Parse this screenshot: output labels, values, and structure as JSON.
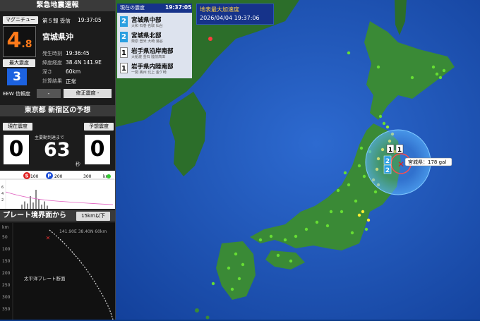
{
  "eew": {
    "title": "緊急地震速報",
    "magnitude_label": "マグニチュード",
    "report_info": "第５報 受信",
    "report_time": "19:37:05",
    "magnitude_int": "4",
    "magnitude_dec": ".8",
    "region": "宮城県沖",
    "origin_time_key": "発生時刻",
    "origin_time": "19:36:45",
    "latlon_key": "緯度経度",
    "latlon": "38.4N 141.9E",
    "max_intensity_label": "最大震度",
    "max_intensity": "3",
    "depth_key": "深さ",
    "depth": "60km",
    "calc_key": "計算結果",
    "calc_result": "正常",
    "reliability_label": "EEW 信頼度",
    "reliability_value": "-",
    "revise_label": "修正震度",
    "revise_value": "-"
  },
  "forecast": {
    "title": "東京都 新宿区の予想",
    "current_label": "現在震度",
    "current_value": "0",
    "arrival_label": "主要動到達まで",
    "seconds": "63",
    "seconds_unit": "秒",
    "predicted_label": "予想震度",
    "predicted_value": "0"
  },
  "wave_chart": {
    "s_label": "S",
    "p_label": "P",
    "ticks": [
      "100",
      "200",
      "300",
      "km"
    ],
    "y_ticks": [
      "6",
      "4",
      "2"
    ],
    "bars": [
      0.2,
      0.35,
      0.25,
      0.6,
      0.3,
      0.9,
      0.45,
      0.2,
      0.35,
      0.15
    ]
  },
  "plate": {
    "title": "プレート境界面から",
    "depth_button": "15km以下",
    "info": "141.90E 38.40N 60km",
    "caption": "太平洋プレート断面",
    "y_unit": "km",
    "y_ticks": [
      "50",
      "100",
      "150",
      "200",
      "250",
      "300",
      "350"
    ]
  },
  "quakes": {
    "header_label": "現在の震度",
    "header_time": "19:37:05",
    "items": [
      {
        "intensity": "2",
        "name": "宮城県中部",
        "sub": "大和 石巻 名取 仙台",
        "color": "#2b9fe0"
      },
      {
        "intensity": "2",
        "name": "宮城県北部",
        "sub": "栗原 登米 大崎 涌谷",
        "color": "#2b9fe0"
      },
      {
        "intensity": "1",
        "name": "岩手県沿岸南部",
        "sub": "大船渡 釜石 陸前高田",
        "color": "#ffffff"
      },
      {
        "intensity": "1",
        "name": "岩手県内陸南部",
        "sub": "一関 奥州 北上 金ケ崎",
        "color": "#ffffff"
      }
    ]
  },
  "pga": {
    "title": "地表最大加速度",
    "datetime": "2026/04/04 19:37:06"
  },
  "map": {
    "tooltip": "宮城県：178 gal",
    "land_color": "#2f7a2f",
    "sea_color": "#1a4fb0"
  }
}
